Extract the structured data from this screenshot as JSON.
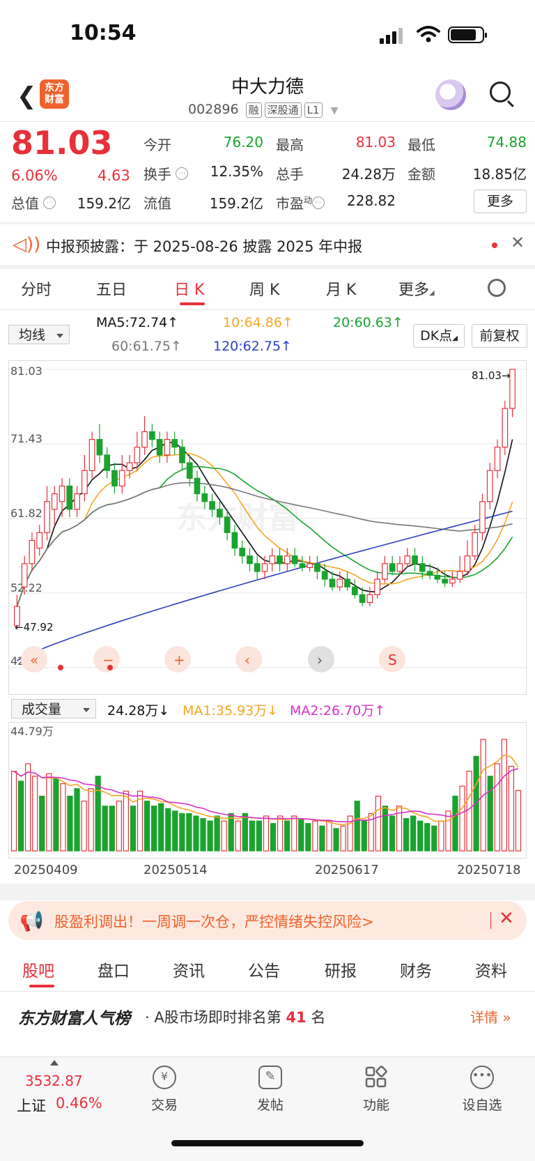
{
  "status": {
    "time": "10:54"
  },
  "header": {
    "back_icon": "chevron-left-icon",
    "logo_text": "东方\n财富",
    "name": "中大力德",
    "code": "002896",
    "tags": [
      "融",
      "深股通",
      "L1"
    ]
  },
  "quote": {
    "price": "81.03",
    "pct": "6.06%",
    "change": "4.63",
    "fields": [
      {
        "label": "今开",
        "value": "76.20",
        "color": "green"
      },
      {
        "label": "最高",
        "value": "81.03",
        "color": "red"
      },
      {
        "label": "最低",
        "value": "74.88",
        "color": "green"
      },
      {
        "label": "换手",
        "value": "12.35%",
        "color": "dark"
      },
      {
        "label": "总手",
        "value": "24.28万",
        "color": "dark"
      },
      {
        "label": "金额",
        "value": "18.85亿",
        "color": "dark"
      },
      {
        "label": "总值",
        "value": "159.2亿",
        "color": "dark"
      },
      {
        "label": "流值",
        "value": "159.2亿",
        "color": "dark"
      },
      {
        "label": "市盈",
        "value": "228.82",
        "color": "dark"
      }
    ],
    "pe_sup": "动",
    "more": "更多"
  },
  "notice": {
    "text": "中报预披露：于 2025-08-26 披露 2025 年中报"
  },
  "tabs": [
    "分时",
    "五日",
    "日 K",
    "周 K",
    "月 K",
    "更多"
  ],
  "ma": {
    "select": "均线",
    "ma5": "MA5:72.74↑",
    "ma10": "10:64.86↑",
    "ma20": "20:60.63↑",
    "ma60": "60:61.75↑",
    "ma120": "120:62.75↑",
    "dk": "DK点",
    "restore": "前复权"
  },
  "chart_data": {
    "type": "candlestick",
    "y_axis_labels": [
      "81.03",
      "71.43",
      "61.82",
      "52.22",
      "42.61"
    ],
    "ylim": [
      42.61,
      81.03
    ],
    "high_marker": "81.03",
    "low_marker": "47.92",
    "watermark": "东方财富",
    "candles": [
      [
        48.0,
        50.5,
        47.92,
        52.0
      ],
      [
        53,
        56,
        52,
        57
      ],
      [
        56,
        59,
        55,
        60
      ],
      [
        58,
        60,
        57,
        61
      ],
      [
        60,
        64,
        59,
        66
      ],
      [
        63,
        65,
        61,
        66
      ],
      [
        64,
        66,
        62,
        67
      ],
      [
        66,
        63,
        62,
        67
      ],
      [
        63,
        65,
        62,
        66
      ],
      [
        65,
        68,
        64,
        70
      ],
      [
        68,
        72,
        67,
        73
      ],
      [
        72,
        70,
        69,
        74
      ],
      [
        70,
        68,
        67,
        71
      ],
      [
        68,
        66,
        65,
        69
      ],
      [
        66,
        68,
        65,
        70
      ],
      [
        68,
        69,
        67,
        70
      ],
      [
        69,
        71,
        68,
        73
      ],
      [
        71,
        73,
        70,
        75
      ],
      [
        73,
        72,
        71,
        74
      ],
      [
        72,
        70,
        69,
        73
      ],
      [
        70,
        72,
        69,
        73
      ],
      [
        72,
        71,
        70,
        73
      ],
      [
        71,
        69,
        68,
        72
      ],
      [
        69,
        67,
        66,
        70
      ],
      [
        67,
        65,
        64,
        68
      ],
      [
        65,
        64,
        63,
        66
      ],
      [
        64,
        63,
        62,
        65
      ],
      [
        63,
        62,
        61,
        64
      ],
      [
        62,
        60,
        59,
        63
      ],
      [
        60,
        58,
        57,
        61
      ],
      [
        58,
        57,
        56,
        59
      ],
      [
        57,
        56,
        55,
        58
      ],
      [
        56,
        55,
        54,
        57
      ],
      [
        55,
        56,
        54,
        57
      ],
      [
        56,
        57,
        55,
        58
      ],
      [
        57,
        56,
        55,
        58
      ],
      [
        56,
        57,
        55,
        58
      ],
      [
        57,
        56,
        55.5,
        58
      ],
      [
        56,
        55.5,
        55,
        57
      ],
      [
        55.5,
        56,
        55,
        57
      ],
      [
        56,
        55,
        54,
        57
      ],
      [
        55,
        54,
        53,
        56
      ],
      [
        54,
        53,
        52.5,
        55
      ],
      [
        53,
        54,
        52.5,
        55
      ],
      [
        54,
        53,
        52.5,
        55
      ],
      [
        53,
        52,
        51.5,
        54
      ],
      [
        52,
        51,
        50.5,
        53
      ],
      [
        51,
        52,
        50.5,
        53
      ],
      [
        52,
        54,
        51.5,
        55
      ],
      [
        54,
        56,
        53.5,
        57
      ],
      [
        56,
        55,
        54.5,
        57
      ],
      [
        55,
        56,
        54.5,
        57
      ],
      [
        56,
        57,
        55.5,
        58
      ],
      [
        57,
        56,
        55,
        58
      ],
      [
        56,
        55,
        54,
        57
      ],
      [
        55,
        54.5,
        54,
        56
      ],
      [
        54.5,
        54,
        53.5,
        55.5
      ],
      [
        54,
        53.5,
        53,
        55
      ],
      [
        53.5,
        54,
        53,
        55
      ],
      [
        54,
        55,
        53.5,
        57
      ],
      [
        55,
        57,
        54.5,
        59
      ],
      [
        57,
        60,
        56.5,
        61
      ],
      [
        60,
        64,
        59,
        65
      ],
      [
        64,
        68,
        63,
        69
      ],
      [
        68,
        71,
        67,
        72
      ],
      [
        71,
        76,
        70,
        77
      ],
      [
        76,
        81.03,
        74.88,
        81.03
      ]
    ],
    "ma_lines": [
      {
        "name": "MA5",
        "color": "#111111"
      },
      {
        "name": "MA10",
        "color": "#f5a623"
      },
      {
        "name": "MA20",
        "color": "#1aa32f"
      },
      {
        "name": "MA60",
        "color": "#777777"
      },
      {
        "name": "MA120",
        "color": "#2d3fbf"
      }
    ],
    "tools": [
      "double-left-icon",
      "minus-icon",
      "plus-icon",
      "left-icon",
      "right-icon",
      "expand-icon"
    ]
  },
  "volume": {
    "select": "成交量",
    "vol": "24.28万↓",
    "ma1": "MA1:35.93万↓",
    "ma2": "MA2:26.70万↑",
    "max_label": "44.79万",
    "bars": [
      32,
      28,
      35,
      30,
      22,
      31,
      29,
      27,
      22,
      25,
      20,
      25,
      30,
      18,
      18,
      20,
      24,
      18,
      24,
      20,
      18,
      19,
      17,
      16,
      15,
      15,
      14,
      13,
      12,
      14,
      12,
      15,
      12,
      15,
      12,
      12,
      14,
      11,
      14,
      12,
      14,
      13,
      11,
      12,
      10,
      12,
      9,
      10,
      14,
      20,
      12,
      15,
      22,
      18,
      14,
      18,
      13,
      14,
      12,
      11,
      10,
      12,
      16,
      22,
      26,
      32,
      38,
      44.79,
      30,
      35,
      44.79,
      34,
      24.28
    ],
    "bar_up": [
      1,
      0,
      1,
      1,
      0,
      1,
      0,
      1,
      0,
      0,
      1,
      1,
      0,
      0,
      0,
      1,
      1,
      0,
      1,
      0,
      0,
      0,
      0,
      0,
      0,
      0,
      0,
      0,
      0,
      0,
      1,
      0,
      1,
      0,
      0,
      0,
      1,
      0,
      1,
      0,
      1,
      0,
      0,
      1,
      0,
      1,
      0,
      1,
      1,
      0,
      0,
      1,
      1,
      0,
      0,
      1,
      0,
      0,
      0,
      0,
      0,
      1,
      1,
      0,
      1,
      1,
      0,
      1,
      0,
      1,
      1,
      1,
      1
    ],
    "dates": [
      "20250409",
      "20250514",
      "20250617",
      "20250718"
    ]
  },
  "promo": {
    "text": "股盈利调出！一周调一次仓，严控情绪失控风险>"
  },
  "bottom_tabs": [
    "股吧",
    "盘口",
    "资讯",
    "公告",
    "研报",
    "财务",
    "资料"
  ],
  "rank": {
    "title": "东方财富人气榜",
    "prefix": "· A股市场即时排名第",
    "num": "41",
    "suffix": "名",
    "more": "详情 »"
  },
  "bottom_nav": {
    "index_value": "3532.87",
    "index_name": "上证",
    "index_pct": "0.46%",
    "items": [
      {
        "label": "交易",
        "icon": "yuan-cycle-icon"
      },
      {
        "label": "发帖",
        "icon": "edit-icon"
      },
      {
        "label": "功能",
        "icon": "grid-icon"
      },
      {
        "label": "设自选",
        "icon": "more-icon"
      }
    ]
  }
}
